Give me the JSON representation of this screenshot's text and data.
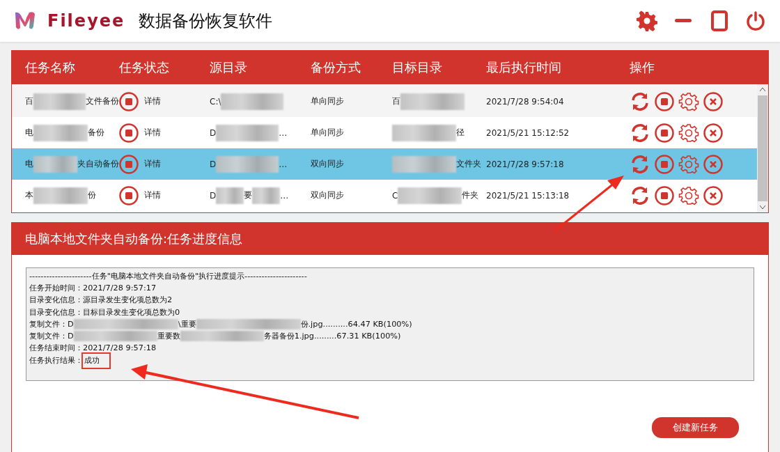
{
  "app": {
    "brand": "Fileyee",
    "title": "数据备份恢复软件"
  },
  "table": {
    "columns": [
      "任务名称",
      "任务状态",
      "源目录",
      "备份方式",
      "目标目录",
      "最后执行时间",
      "操作"
    ],
    "rows": [
      {
        "selected": false,
        "name": [
          {
            "kind": "text",
            "text": "百"
          },
          {
            "kind": "blur"
          },
          {
            "kind": "text",
            "text": "文件备份"
          }
        ],
        "detail": "详情",
        "source": [
          {
            "kind": "text",
            "text": "C:\\"
          },
          {
            "kind": "blur"
          }
        ],
        "method": "单向同步",
        "target": [
          {
            "kind": "text",
            "text": "百"
          },
          {
            "kind": "blur"
          }
        ],
        "time": "2021/7/28 9:54:04"
      },
      {
        "selected": false,
        "name": [
          {
            "kind": "text",
            "text": "电"
          },
          {
            "kind": "blur"
          },
          {
            "kind": "text",
            "text": "备份"
          }
        ],
        "detail": "详情",
        "source": [
          {
            "kind": "text",
            "text": "D"
          },
          {
            "kind": "blur"
          },
          {
            "kind": "text",
            "text": "…"
          }
        ],
        "method": "单向同步",
        "target": [
          {
            "kind": "blur"
          },
          {
            "kind": "text",
            "text": "径"
          }
        ],
        "time": "2021/5/21 15:12:52"
      },
      {
        "selected": true,
        "name": [
          {
            "kind": "text",
            "text": "电"
          },
          {
            "kind": "blur"
          },
          {
            "kind": "text",
            "text": "夹自动备份"
          }
        ],
        "detail": "详情",
        "source": [
          {
            "kind": "text",
            "text": "D"
          },
          {
            "kind": "blur"
          },
          {
            "kind": "text",
            "text": "…"
          }
        ],
        "method": "双向同步",
        "target": [
          {
            "kind": "blur"
          },
          {
            "kind": "text",
            "text": "文件夹"
          }
        ],
        "time": "2021/7/28 9:57:18"
      },
      {
        "selected": false,
        "name": [
          {
            "kind": "text",
            "text": "本"
          },
          {
            "kind": "blur"
          },
          {
            "kind": "text",
            "text": "份"
          }
        ],
        "detail": "详情",
        "source": [
          {
            "kind": "text",
            "text": "D"
          },
          {
            "kind": "blur"
          },
          {
            "kind": "text",
            "text": "要"
          },
          {
            "kind": "blur"
          },
          {
            "kind": "text",
            "text": "…"
          }
        ],
        "method": "双向同步",
        "target": [
          {
            "kind": "text",
            "text": "C"
          },
          {
            "kind": "blur"
          },
          {
            "kind": "text",
            "text": "件夹"
          }
        ],
        "time": "2021/5/21 15:13:18"
      }
    ]
  },
  "progress": {
    "title": "电脑本地文件夹自动备份:任务进度信息",
    "log": [
      [
        {
          "kind": "text",
          "text": "----------------------任务\"电脑本地文件夹自动备份\"执行进度提示----------------------"
        }
      ],
      [
        {
          "kind": "text",
          "text": "任务开始时间：2021/7/28 9:57:17"
        }
      ],
      [
        {
          "kind": "text",
          "text": "目录变化信息：源目录发生变化项总数为2"
        }
      ],
      [
        {
          "kind": "text",
          "text": "目录变化信息：目标目录发生变化项总数为0"
        }
      ],
      [
        {
          "kind": "text",
          "text": "复制文件：D"
        },
        {
          "kind": "blur"
        },
        {
          "kind": "text",
          "text": "\\重要"
        },
        {
          "kind": "blur"
        },
        {
          "kind": "text",
          "text": "份.jpg..........64.47 KB(100%)"
        }
      ],
      [
        {
          "kind": "text",
          "text": "复制文件：D"
        },
        {
          "kind": "blur"
        },
        {
          "kind": "text",
          "text": "重要数"
        },
        {
          "kind": "blur"
        },
        {
          "kind": "text",
          "text": "务器备份1.jpg.........67.31 KB(100%)"
        }
      ],
      [
        {
          "kind": "text",
          "text": "任务结束时间：2021/7/28 9:57:18"
        }
      ],
      [
        {
          "kind": "text",
          "text": "任务执行结果："
        },
        {
          "kind": "mark",
          "text": "成功"
        }
      ]
    ]
  },
  "buttons": [
    "创建新任务"
  ]
}
